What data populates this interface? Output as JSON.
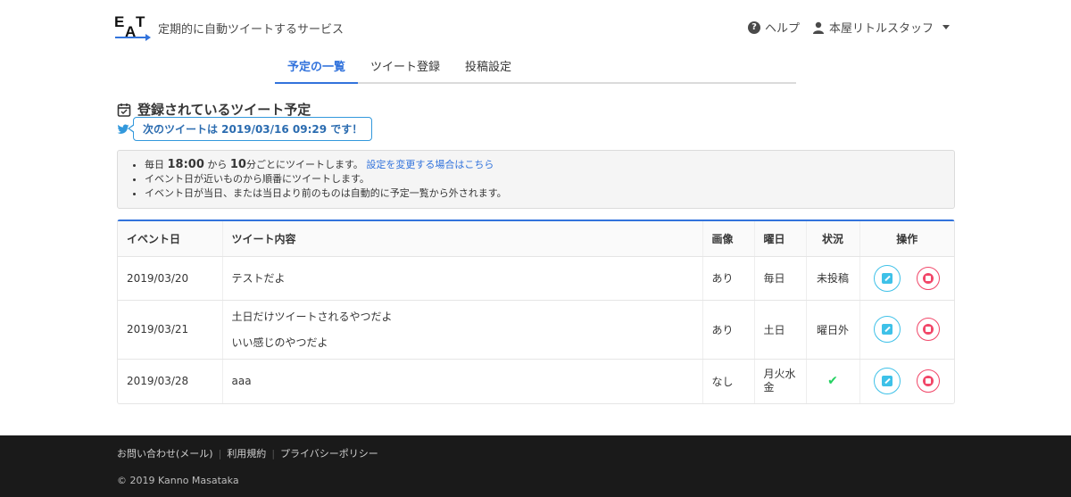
{
  "header": {
    "logo_e": "E",
    "logo_a": "A",
    "logo_t": "T",
    "tagline": "定期的に自動ツイートするサービス",
    "help_label": "ヘルプ",
    "user_name": "本屋リトルスタッフ",
    "accent": "#3273dc"
  },
  "tabs": [
    {
      "label": "予定の一覧",
      "active": true
    },
    {
      "label": "ツイート登録",
      "active": false
    },
    {
      "label": "投稿設定",
      "active": false
    }
  ],
  "section": {
    "title": "登録されているツイート予定",
    "next_tweet": "次のツイートは 2019/03/16 09:29 です！"
  },
  "info": {
    "line1_prefix": "毎日",
    "line1_time": "18:00",
    "line1_mid": "から",
    "line1_interval": "10",
    "line1_suffix": "分ごとにツイートします。",
    "line1_link": "設定を変更する場合はこちら",
    "line2": "イベント日が近いものから順番にツイートします。",
    "line3": "イベント日が当日、または当日より前のものは自動的に予定一覧から外されます。"
  },
  "table": {
    "headers": {
      "date": "イベント日",
      "content": "ツイート内容",
      "image": "画像",
      "day": "曜日",
      "status": "状況",
      "ops": "操作"
    },
    "rows": [
      {
        "date": "2019/03/20",
        "content1": "テストだよ",
        "content2": "",
        "image": "あり",
        "day": "毎日",
        "status": "未投稿"
      },
      {
        "date": "2019/03/21",
        "content1": "土日だけツイートされるやつだよ",
        "content2": "いい感じのやつだよ",
        "image": "あり",
        "day": "土日",
        "status": "曜日外"
      },
      {
        "date": "2019/03/28",
        "content1": "aaa",
        "content2": "",
        "image": "なし",
        "day": "月火水金",
        "status": "✔"
      }
    ]
  },
  "footer": {
    "link_contact": "お問い合わせ(メール)",
    "link_terms": "利用規約",
    "link_privacy": "プライバシーポリシー",
    "copyright": "© 2019 Kanno Masataka"
  }
}
